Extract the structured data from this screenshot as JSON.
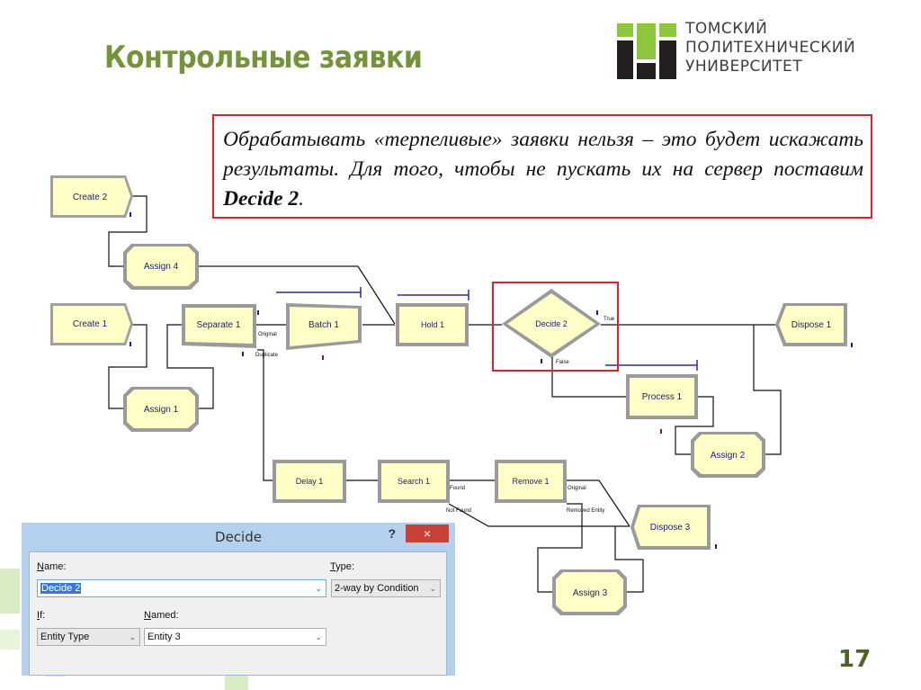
{
  "slide": {
    "title": "Контрольные заявки",
    "page_number": "17",
    "accent_color": "#76923c"
  },
  "logo": {
    "line1": "ТОМСКИЙ",
    "line2": "ПОЛИТЕХНИЧЕСКИЙ",
    "line3": "УНИВЕРСИТЕТ",
    "green": "#8cc63f",
    "dark": "#231f20"
  },
  "note": {
    "text": "Обрабатывать «терпеливые» заявки нельзя – это будет искажать результаты. Для того, чтобы не пускать их на сервер поставим ",
    "bold": "Decide 2",
    "end": ".",
    "border_color": "#e0202a"
  },
  "diagram": {
    "modules": {
      "create2": "Create 2",
      "assign4": "Assign 4",
      "create1": "Create 1",
      "separate1": "Separate 1",
      "batch1": "Batch 1",
      "hold1": "Hold 1",
      "decide2": "Decide 2",
      "dispose1": "Dispose 1",
      "assign1": "Assign 1",
      "process1": "Process 1",
      "assign2": "Assign 2",
      "delay1": "Delay 1",
      "search1": "Search 1",
      "remove1": "Remove 1",
      "dispose3": "Dispose 3",
      "assign3": "Assign 3"
    },
    "labels": {
      "original_sep": "Original",
      "duplicate": "Duplicate",
      "true": "True",
      "false": "False",
      "found": "Found",
      "not_found": "Not Found",
      "original_rem": "Original",
      "removed_entity": "Removed Entity"
    },
    "module_fill": "#ffffc8",
    "highlight_color": "#e0202a"
  },
  "dialog": {
    "title": "Decide",
    "help": "?",
    "close": "×",
    "name_label": "ame:",
    "name_label_u": "N",
    "name_value": "Decide 2",
    "type_label": "ype:",
    "type_label_u": "T",
    "type_value": "2-way by Condition",
    "if_label": "f:",
    "if_label_u": "I",
    "if_value": "Entity Type",
    "named_label": "amed:",
    "named_label_u": "N",
    "named_value": "Entity 3"
  }
}
